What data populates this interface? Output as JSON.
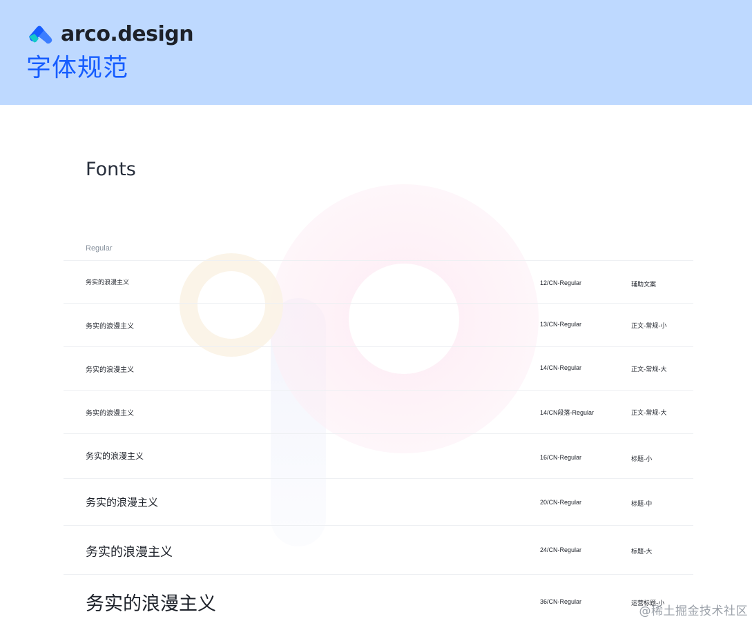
{
  "header": {
    "brand_name": "arco.design",
    "doc_title": "字体规范",
    "logo_icon": "arco-logo-icon",
    "colors": {
      "band": "#bed9ff",
      "title": "#165dff",
      "logo_primary": "#165dff",
      "logo_secondary": "#14c9c9"
    }
  },
  "main": {
    "section_title": "Fonts",
    "weight_label": "Regular",
    "rows": [
      {
        "sample": "务实的浪漫主义",
        "spec": "12/CN-Regular",
        "usage": "辅助文案"
      },
      {
        "sample": "务实的浪漫主义",
        "spec": "13/CN-Regular",
        "usage": "正文-常规-小"
      },
      {
        "sample": "务实的浪漫主义",
        "spec": "14/CN-Regular",
        "usage": "正文-常规-大"
      },
      {
        "sample": "务实的浪漫主义",
        "spec": "14/CN段落-Regular",
        "usage": "正文-常规-大"
      },
      {
        "sample": "务实的浪漫主义",
        "spec": "16/CN-Regular",
        "usage": "标题-小"
      },
      {
        "sample": "务实的浪漫主义",
        "spec": "20/CN-Regular",
        "usage": "标题-中"
      },
      {
        "sample": "务实的浪漫主义",
        "spec": "24/CN-Regular",
        "usage": "标题-大"
      },
      {
        "sample": "务实的浪漫主义",
        "spec": "36/CN-Regular",
        "usage": "运营标题-小"
      }
    ]
  },
  "watermark": "@稀土掘金技术社区"
}
